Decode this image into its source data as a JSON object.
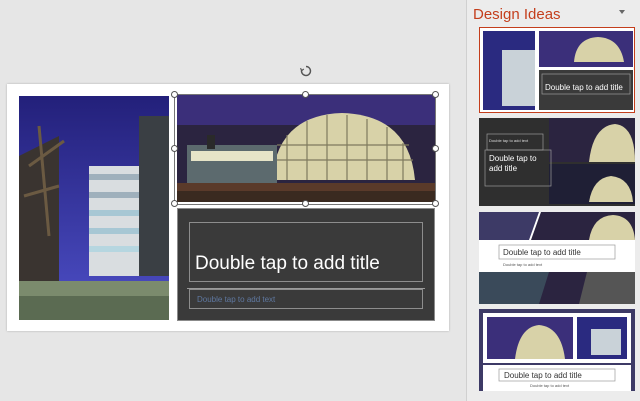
{
  "slide": {
    "title_placeholder": "Double tap to add title",
    "subtitle_placeholder": "Double tap to add text"
  },
  "design_ideas": {
    "heading": "Design Ideas",
    "thumbnails": [
      {
        "title": "Double tap to add title"
      },
      {
        "small_label": "Double tap to add text",
        "title": "Double tap to add title"
      },
      {
        "title": "Double tap to add title",
        "subtitle": "Double tap to add text"
      },
      {
        "title": "Double tap to add title",
        "subtitle": "Double tap to add text"
      }
    ]
  },
  "colors": {
    "accent": "#c43e1c",
    "panel": "#3a3a3a",
    "night_sky": "#3b2f7a"
  },
  "icons": [
    "rotate-handle-icon",
    "chevron-down-icon"
  ]
}
